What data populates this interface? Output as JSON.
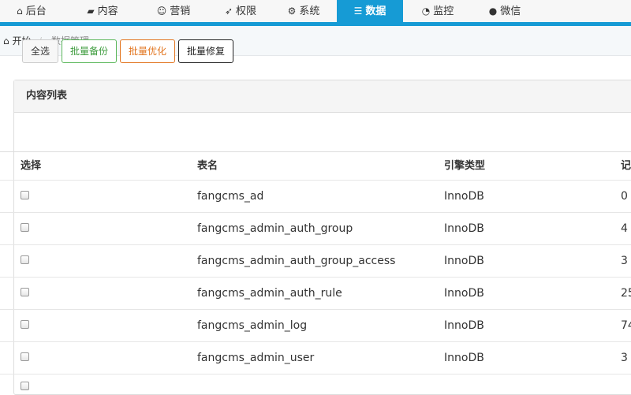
{
  "nav": {
    "items": [
      {
        "label": "后台",
        "icon": "home-icon"
      },
      {
        "label": "内容",
        "icon": "folder-icon"
      },
      {
        "label": "营销",
        "icon": "smile-icon"
      },
      {
        "label": "权限",
        "icon": "rocket-icon"
      },
      {
        "label": "系统",
        "icon": "gear-icon"
      },
      {
        "label": "数据",
        "icon": "database-icon",
        "active": true
      },
      {
        "label": "监控",
        "icon": "dashboard-icon"
      },
      {
        "label": "微信",
        "icon": "wechat-icon"
      }
    ],
    "accent": "#169bd5"
  },
  "breadcrumb": {
    "home": "开始",
    "current": "数据管理"
  },
  "panel": {
    "title": "内容列表"
  },
  "toolbar": {
    "select_all": "全选",
    "batch_backup": "批量备份",
    "batch_optimize": "批量优化",
    "batch_repair": "批量修复"
  },
  "table": {
    "headers": [
      "选择",
      "表名",
      "引擎类型",
      "记"
    ],
    "rows": [
      {
        "name": "fangcms_ad",
        "engine": "InnoDB",
        "records": "0"
      },
      {
        "name": "fangcms_admin_auth_group",
        "engine": "InnoDB",
        "records": "4"
      },
      {
        "name": "fangcms_admin_auth_group_access",
        "engine": "InnoDB",
        "records": "3"
      },
      {
        "name": "fangcms_admin_auth_rule",
        "engine": "InnoDB",
        "records": "25"
      },
      {
        "name": "fangcms_admin_log",
        "engine": "InnoDB",
        "records": "74"
      },
      {
        "name": "fangcms_admin_user",
        "engine": "InnoDB",
        "records": "3"
      }
    ]
  }
}
